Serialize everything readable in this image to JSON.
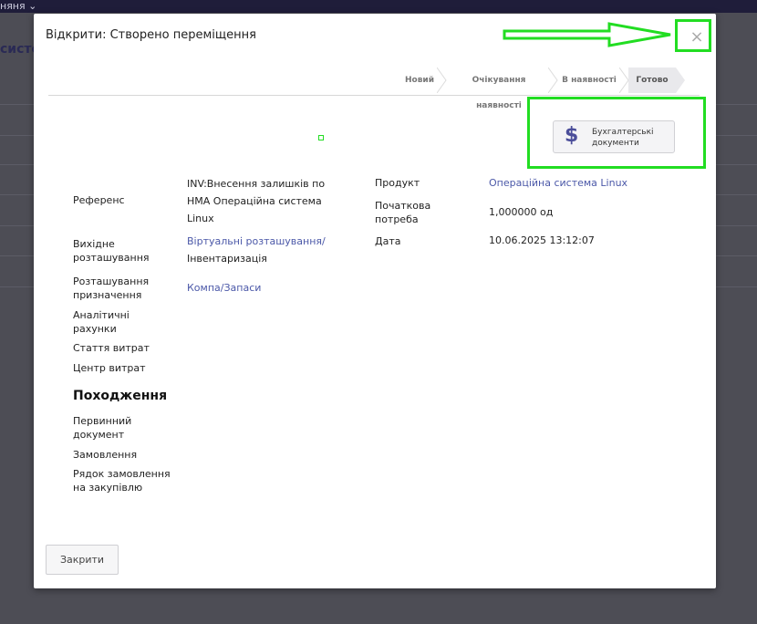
{
  "background": {
    "topbar_fragment": "няня ⌄",
    "title_fragment": "систе"
  },
  "modal": {
    "title": "Відкрити: Створено переміщення",
    "close_symbol": "×",
    "status_stages": [
      "Новий",
      "Очікування наявності",
      "В наявності",
      "Готово"
    ],
    "active_stage": "Готово",
    "accounting_button": {
      "line1": "Бухгалтерські",
      "line2": "документи",
      "icon": "dollar-icon"
    },
    "fields_left": {
      "reference_label": "Референс",
      "reference_value_1": "INV:Внесення залишків по",
      "reference_value_2": "НМА Операційна система",
      "reference_value_3": "Linux",
      "source_location_label_1": "Вихідне",
      "source_location_label_2": "розташування",
      "source_location_value_1": "Віртуальні розташування/",
      "source_location_value_2": "Інвентаризація",
      "dest_location_label_1": "Розташування",
      "dest_location_label_2": "призначення",
      "dest_location_value": "Компа/Запаси",
      "analytic_label_1": "Аналітичні",
      "analytic_label_2": "рахунки",
      "expense_item_label": "Стаття витрат",
      "cost_center_label": "Центр витрат"
    },
    "fields_right": {
      "product_label": "Продукт",
      "product_value": "Операційна система Linux",
      "initial_demand_label_1": "Початкова",
      "initial_demand_label_2": "потреба",
      "initial_demand_value": "1,000000 од",
      "date_label": "Дата",
      "date_value": "10.06.2025 13:12:07"
    },
    "origin_section": {
      "heading": "Походження",
      "source_doc_label_1": "Первинний",
      "source_doc_label_2": "документ",
      "order_label": "Замовлення",
      "po_line_label_1": "Рядок замовлення",
      "po_line_label_2": "на закупівлю"
    },
    "footer": {
      "close_button": "Закрити"
    }
  },
  "colors": {
    "highlight": "#22dd22",
    "link": "#4b58a8",
    "accent_icon": "#4b4e9a"
  }
}
